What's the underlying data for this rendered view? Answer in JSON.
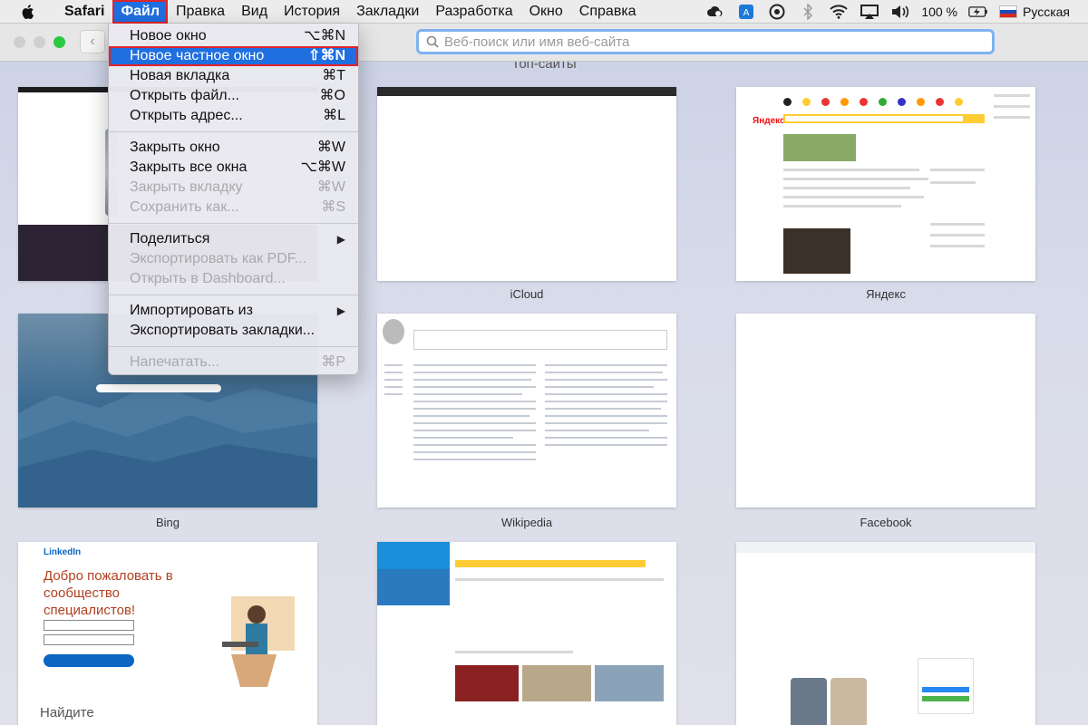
{
  "menubar": {
    "app": "Safari",
    "items": [
      "Файл",
      "Правка",
      "Вид",
      "История",
      "Закладки",
      "Разработка",
      "Окно",
      "Справка"
    ],
    "battery": "100 %",
    "input_source": "Русская"
  },
  "toolbar": {
    "address_placeholder": "Веб-поиск или имя веб-сайта"
  },
  "topsites": {
    "title": "Топ-сайты",
    "tiles": [
      {
        "label": ""
      },
      {
        "label": "iCloud"
      },
      {
        "label": "Яндекс"
      },
      {
        "label": "Bing"
      },
      {
        "label": "Wikipedia"
      },
      {
        "label": "Facebook"
      },
      {
        "label": ""
      },
      {
        "label": ""
      },
      {
        "label": ""
      }
    ],
    "thumbnails": {
      "yandex_logo": "Яндекс",
      "linkedin_logo": "LinkedIn",
      "linkedin_title": "Добро пожаловать в сообщество специалистов!",
      "linkedin_find": "Найдите"
    }
  },
  "file_menu": {
    "items": [
      {
        "label": "Новое окно",
        "shortcut": "⌥⌘N"
      },
      {
        "label": "Новое частное окно",
        "shortcut": "⇧⌘N"
      },
      {
        "label": "Новая вкладка",
        "shortcut": "⌘T"
      },
      {
        "label": "Открыть файл...",
        "shortcut": "⌘O"
      },
      {
        "label": "Открыть адрес...",
        "shortcut": "⌘L"
      },
      {
        "label": "Закрыть окно",
        "shortcut": "⌘W"
      },
      {
        "label": "Закрыть все окна",
        "shortcut": "⌥⌘W"
      },
      {
        "label": "Закрыть вкладку",
        "shortcut": "⌘W"
      },
      {
        "label": "Сохранить как...",
        "shortcut": "⌘S"
      },
      {
        "label": "Поделиться",
        "shortcut": ""
      },
      {
        "label": "Экспортировать как PDF...",
        "shortcut": ""
      },
      {
        "label": "Открыть в Dashboard...",
        "shortcut": ""
      },
      {
        "label": "Импортировать из",
        "shortcut": ""
      },
      {
        "label": "Экспортировать закладки...",
        "shortcut": ""
      },
      {
        "label": "Напечатать...",
        "shortcut": "⌘P"
      }
    ]
  }
}
